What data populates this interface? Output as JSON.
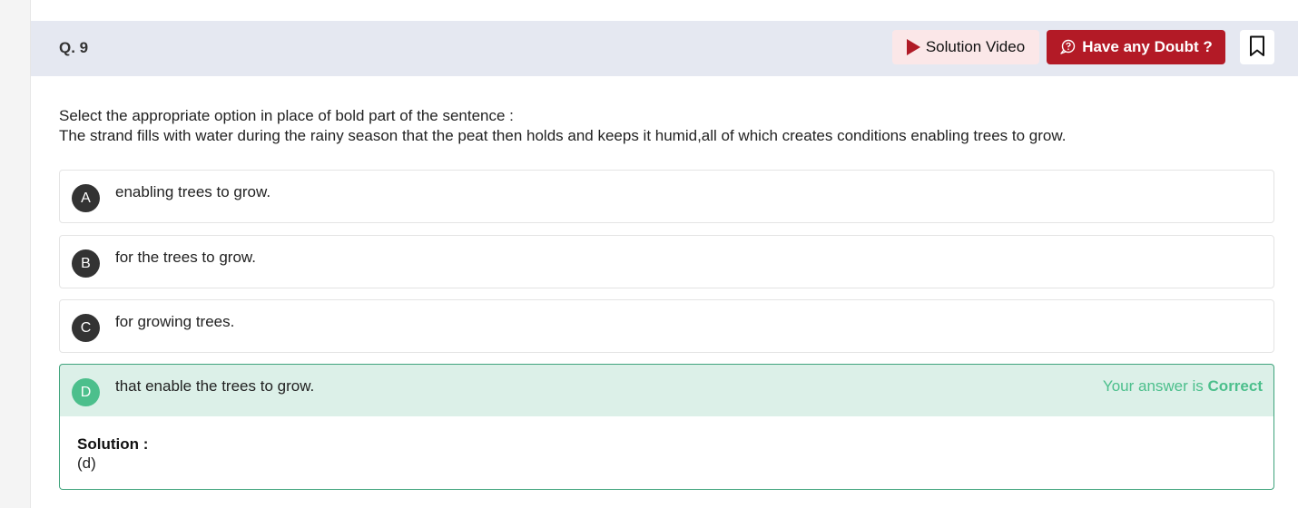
{
  "header": {
    "question_number": "Q. 9",
    "solution_video_label": "Solution Video",
    "doubt_label": "Have any Doubt ?"
  },
  "question": {
    "instruction": "Select the appropriate option in place of bold part of the sentence :",
    "sentence": "The strand fills with water during the rainy season that the peat then holds and keeps it humid,all of which creates conditions enabling trees to grow."
  },
  "options": [
    {
      "letter": "A",
      "text": "enabling trees to grow."
    },
    {
      "letter": "B",
      "text": "for the trees to grow."
    },
    {
      "letter": "C",
      "text": "for growing trees."
    },
    {
      "letter": "D",
      "text": "that enable the trees to grow."
    }
  ],
  "result": {
    "prefix": "Your answer is ",
    "status": "Correct"
  },
  "solution": {
    "title": "Solution :",
    "value": "(d)"
  },
  "colors": {
    "accent": "#b31a26",
    "correct": "#4cbf8c",
    "header_bg": "#e5e8f1"
  },
  "icons": [
    "play-icon",
    "doubt-icon",
    "bookmark-icon"
  ]
}
